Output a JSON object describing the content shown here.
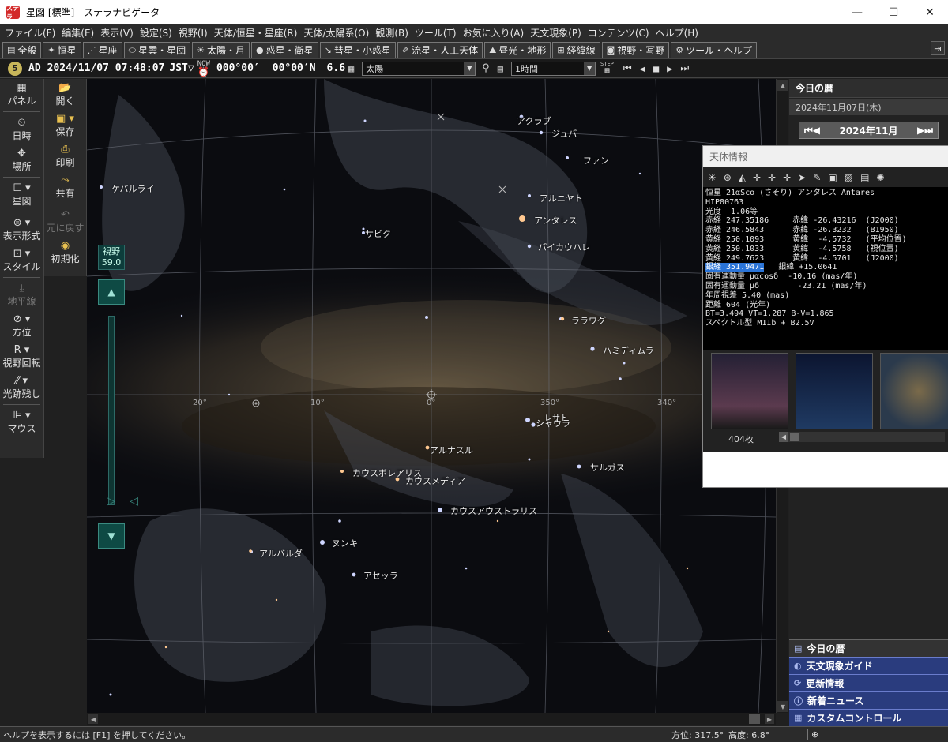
{
  "window": {
    "title": "星図 [標準] - ステラナビゲータ",
    "app_icon": "ステラ"
  },
  "menu": [
    "ファイル(F)",
    "編集(E)",
    "表示(V)",
    "設定(S)",
    "視野(I)",
    "天体/恒星・星座(R)",
    "天体/太陽系(O)",
    "観測(B)",
    "ツール(T)",
    "お気に入り(A)",
    "天文現象(P)",
    "コンテンツ(C)",
    "ヘルプ(H)"
  ],
  "tabs": [
    {
      "label": "全般",
      "icon": "window-icon"
    },
    {
      "label": "恒星",
      "icon": "star-icon"
    },
    {
      "label": "星座",
      "icon": "constellation-icon"
    },
    {
      "label": "星雲・星団",
      "icon": "nebula-icon"
    },
    {
      "label": "太陽・月",
      "icon": "sun-icon"
    },
    {
      "label": "惑星・衛星",
      "icon": "planet-icon"
    },
    {
      "label": "彗星・小惑星",
      "icon": "comet-icon"
    },
    {
      "label": "流星・人工天体",
      "icon": "meteor-icon"
    },
    {
      "label": "昼光・地形",
      "icon": "landscape-icon"
    },
    {
      "label": "経緯線",
      "icon": "grid-icon"
    },
    {
      "label": "視野・写野",
      "icon": "camera-icon"
    },
    {
      "label": "ツール・ヘルプ",
      "icon": "gear-icon"
    }
  ],
  "timebar": {
    "badge": "5",
    "era": "AD",
    "datetime": "2024/11/07 07:48:07",
    "tz": "JST▽",
    "now_label": "NOW",
    "lon": "000°00′",
    "lat": "00°00′N",
    "mag": "6.6",
    "target": "太陽",
    "step": "1時間",
    "step_label": "STEP"
  },
  "left_toolbar": [
    {
      "label": "パネル",
      "icon": "panel-icon",
      "dim": false
    },
    {
      "label": "日時",
      "icon": "clock-icon",
      "dim": false
    },
    {
      "label": "場所",
      "icon": "location-icon",
      "dim": false
    },
    {
      "label": "星図",
      "icon": "chart-icon",
      "dim": false
    },
    {
      "label": "表示形式",
      "icon": "display-mode-icon",
      "dim": false
    },
    {
      "label": "スタイル",
      "icon": "style-icon",
      "dim": false
    },
    {
      "label": "地平線",
      "icon": "horizon-icon",
      "dim": true
    },
    {
      "label": "方位",
      "icon": "compass-icon",
      "dim": false
    },
    {
      "label": "視野回転",
      "icon": "rotate-icon",
      "dim": false
    },
    {
      "label": "光跡残し",
      "icon": "trail-icon",
      "dim": false
    },
    {
      "label": "マウス",
      "icon": "mouse-icon",
      "dim": false
    }
  ],
  "left_toolbar2": [
    {
      "label": "開く",
      "icon": "folder-icon",
      "dim": false
    },
    {
      "label": "保存",
      "icon": "save-icon",
      "dim": false
    },
    {
      "label": "印刷",
      "icon": "print-icon",
      "dim": false
    },
    {
      "label": "共有",
      "icon": "share-icon",
      "dim": false
    },
    {
      "label": "元に戻す",
      "icon": "undo-icon",
      "dim": true
    },
    {
      "label": "初期化",
      "icon": "reset-icon",
      "dim": false
    }
  ],
  "fov": {
    "label": "視野",
    "value": "59.0"
  },
  "sky_labels": [
    "アクラブ",
    "ジュバ",
    "ファン",
    "ケバルライ",
    "アルニヤト",
    "アンタレス",
    "サビク",
    "パイカウハレ",
    "ララワグ",
    "ハミディムラ",
    "レサト",
    "シャウラ",
    "アルナスル",
    "サルガス",
    "カウスボレアリス",
    "カウスメディア",
    "カウスアウストラリス",
    "ヌンキ",
    "アルバルダ",
    "アセッラ"
  ],
  "degrees": [
    "20°",
    "10°",
    "0°",
    "350°",
    "340°"
  ],
  "right_panel": {
    "header": "今日の暦",
    "date": "2024年11月07日(木)",
    "month": "2024年11月",
    "sections": [
      "今日の暦",
      "天文現象ガイド",
      "更新情報",
      "新着ニュース",
      "カスタムコントロール"
    ]
  },
  "info_window": {
    "title": "天体情報",
    "lines": [
      "恒星 21αSco (さそり) アンタレス Antares",
      "HIP80763",
      "光度  1.06等",
      "赤経 247.35186     赤緯 -26.43216  (J2000)",
      "赤経 246.5843      赤緯 -26.3232   (B1950)",
      "黄経 250.1093      黄緯  -4.5732   (平均位置)",
      "黄経 250.1033      黄緯  -4.5758   (視位置)",
      "黄経 249.7623      黄緯  -4.5701   (J2000)",
      "",
      "固有運動量 μαcosδ  -10.16 (mas/年)",
      "固有運動量 μδ        -23.21 (mas/年)",
      "年周視差 5.40 (mas)",
      "距離 604 (光年)",
      "BT=3.494 VT=1.287 B-V=1.865",
      "スペクトル型 M1Ib + B2.5V"
    ],
    "galactic_lon": "銀経 351.9471",
    "galactic_lat": "   銀緯 +15.0641",
    "photo_count": "404枚"
  },
  "status": {
    "help": "ヘルプを表示するには [F1] を押してください。",
    "azimuth": "方位: 317.5°",
    "altitude": "高度:  6.8°"
  }
}
